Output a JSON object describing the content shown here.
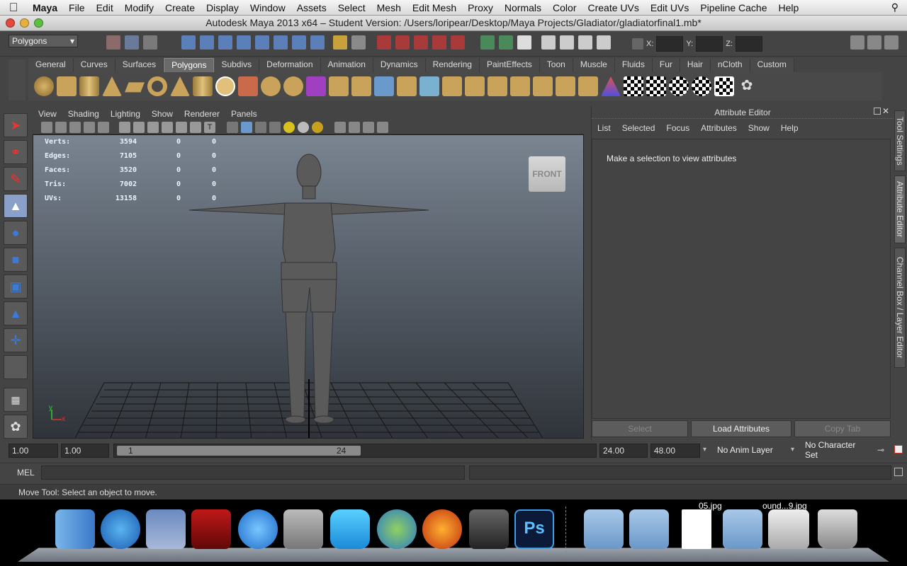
{
  "mac_menubar": {
    "items": [
      "Maya",
      "File",
      "Edit",
      "Modify",
      "Create",
      "Display",
      "Window",
      "Assets",
      "Select",
      "Mesh",
      "Edit Mesh",
      "Proxy",
      "Normals",
      "Color",
      "Create UVs",
      "Edit UVs",
      "Pipeline Cache",
      "Help"
    ]
  },
  "window": {
    "title": "Autodesk Maya 2013 x64 – Student Version: /Users/loripear/Desktop/Maya Projects/Gladiator/gladiatorfinal1.mb*"
  },
  "status_line": {
    "menuset": "Polygons",
    "x_label": "X:",
    "y_label": "Y:",
    "z_label": "Z:"
  },
  "shelf": {
    "tabs": [
      "General",
      "Curves",
      "Surfaces",
      "Polygons",
      "Subdivs",
      "Deformation",
      "Animation",
      "Dynamics",
      "Rendering",
      "PaintEffects",
      "Toon",
      "Muscle",
      "Fluids",
      "Fur",
      "Hair",
      "nCloth",
      "Custom"
    ],
    "active_tab": "Polygons"
  },
  "viewport": {
    "menu": [
      "View",
      "Shading",
      "Lighting",
      "Show",
      "Renderer",
      "Panels"
    ],
    "view_cube_label": "FRONT",
    "hud": {
      "rows": [
        {
          "label": "Verts:",
          "v1": "3594",
          "v2": "0",
          "v3": "0"
        },
        {
          "label": "Edges:",
          "v1": "7105",
          "v2": "0",
          "v3": "0"
        },
        {
          "label": "Faces:",
          "v1": "3520",
          "v2": "0",
          "v3": "0"
        },
        {
          "label": "Tris:",
          "v1": "7002",
          "v2": "0",
          "v3": "0"
        },
        {
          "label": "UVs:",
          "v1": "13158",
          "v2": "0",
          "v3": "0"
        }
      ]
    },
    "axis_y": "y",
    "axis_x": "x"
  },
  "attribute_editor": {
    "title": "Attribute Editor",
    "menu": [
      "List",
      "Selected",
      "Focus",
      "Attributes",
      "Show",
      "Help"
    ],
    "message": "Make a selection to view attributes",
    "buttons": {
      "select": "Select",
      "load": "Load Attributes",
      "copy": "Copy Tab"
    }
  },
  "side_tabs": [
    "Tool Settings",
    "Attribute Editor",
    "Channel Box / Layer Editor"
  ],
  "timeline": {
    "start_time": "1.00",
    "playback_start": "1.00",
    "range_start": "1",
    "range_end": "24",
    "playback_end": "24.00",
    "end_time": "48.00",
    "anim_layer": "No Anim Layer",
    "character_set": "No Character Set"
  },
  "command_line": {
    "label": "MEL"
  },
  "help_line": {
    "text": "Move Tool: Select an object to move."
  },
  "dock": {
    "labels": {
      "stack1": "05.jpg",
      "stack2": "ound...9.jpg"
    }
  },
  "colors": {
    "maya_bg": "#444444",
    "viewport_top": "#7a8591",
    "viewport_bottom": "#30343a",
    "hud_text": "#e8f4ff"
  }
}
